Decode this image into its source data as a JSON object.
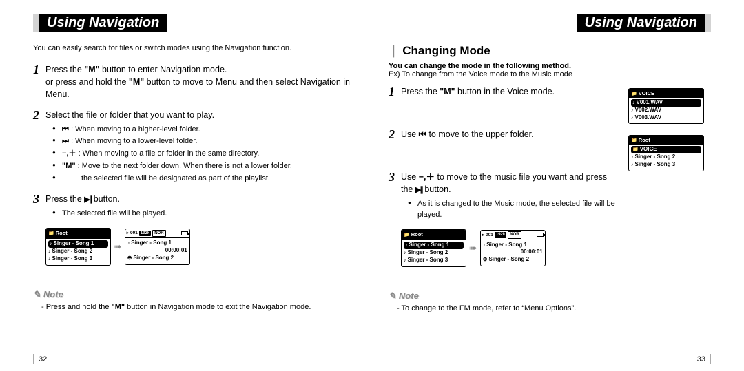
{
  "page_left": {
    "heading": "Using Navigation",
    "intro": "You can easily search for files or switch modes using the Navigation function.",
    "steps": [
      {
        "num": "1",
        "text_a": "Press the ",
        "bold_a": "\"M\"",
        "text_b": " button to enter Navigation mode.",
        "text_c": "or press and hold the ",
        "bold_b": "\"M\"",
        "text_d": " button to move to Menu and then select Navigation in Menu."
      },
      {
        "num": "2",
        "text_a": "Select the file or folder that you want to play.",
        "subitems": [
          {
            "glyph": "rew",
            "text": ": When moving to a higher-level folder."
          },
          {
            "glyph": "ffw",
            "text": ": When moving to a lower-level folder."
          },
          {
            "glyph": "pm",
            "text": ": When moving to a file or folder in the same directory."
          },
          {
            "glyph": "none",
            "bold": "\"M\"",
            "text": " : Move to the next folder down. When there is not a lower folder,"
          },
          {
            "glyph": "indent",
            "text": "the selected file will be designated as part of the playlist."
          }
        ]
      },
      {
        "num": "3",
        "text_a": "Press the ",
        "glyph": "playpause",
        "text_b": " button.",
        "subitems": [
          {
            "glyph": "none",
            "text": "The selected file will be played."
          }
        ]
      }
    ],
    "screen_a": {
      "header_icon": "folder",
      "header": "Root",
      "rows": [
        {
          "icon": "note",
          "text": "Singer - Song 1",
          "hl": true
        },
        {
          "icon": "note",
          "text": "Singer - Song 2"
        },
        {
          "icon": "note",
          "text": "Singer - Song 3"
        }
      ]
    },
    "screen_b": {
      "status": {
        "track": "001",
        "bitrate": "192k",
        "nor": "NOR"
      },
      "now_playing_icon": "note",
      "now_playing": "Singer - Song 1",
      "time": "00:00:01",
      "next_icon": "next",
      "next": "Singer - Song 2"
    },
    "note": {
      "label": "Note",
      "text_a": "- Press and hold the ",
      "bold": "\"M\"",
      "text_b": " button in Navigation mode to exit the Navigation mode."
    },
    "page_number": "32"
  },
  "page_right": {
    "heading": "Using Navigation",
    "section_title": "Changing Mode",
    "sub_intro": "You can change the mode in the following method.",
    "sub_example": "Ex) To change from the Voice mode to the Music mode",
    "steps": [
      {
        "num": "1",
        "text_a": "Press the ",
        "bold_a": "\"M\"",
        "text_b": " button in the Voice mode."
      },
      {
        "num": "2",
        "text_a": "Use ",
        "glyph": "rew",
        "text_b": " to move to the upper folder."
      },
      {
        "num": "3",
        "text_a": "Use ",
        "glyph": "pm",
        "text_b": " to move to the music file you want and press the ",
        "glyph2": "playpause",
        "text_c": " button.",
        "subitems": [
          {
            "glyph": "none",
            "text": "As it is changed to the Music mode, the selected file will be played."
          }
        ]
      }
    ],
    "screen_voice": {
      "header_icon": "folder",
      "header": "VOICE",
      "rows": [
        {
          "icon": "note",
          "text": "V001.WAV",
          "hl": true
        },
        {
          "icon": "note",
          "text": "V002.WAV"
        },
        {
          "icon": "note",
          "text": "V003.WAV"
        }
      ]
    },
    "screen_root": {
      "header_icon": "folder",
      "header": "Root",
      "rows": [
        {
          "icon": "folder",
          "text": "VOICE",
          "hl": true
        },
        {
          "icon": "note",
          "text": "Singer - Song 2"
        },
        {
          "icon": "note",
          "text": "Singer - Song 3"
        }
      ]
    },
    "screen_a": {
      "header_icon": "folder",
      "header": "Root",
      "rows": [
        {
          "icon": "note",
          "text": "Singer - Song 1",
          "hl": true
        },
        {
          "icon": "note",
          "text": "Singer - Song 2"
        },
        {
          "icon": "note",
          "text": "Singer - Song 3"
        }
      ]
    },
    "screen_b": {
      "status": {
        "track": "001",
        "bitrate": "192k",
        "nor": "NOR"
      },
      "now_playing_icon": "note",
      "now_playing": "Singer - Song 1",
      "time": "00:00:01",
      "next_icon": "next",
      "next": "Singer - Song 2"
    },
    "note": {
      "label": "Note",
      "text": "- To change to the FM mode, refer to “Menu Options”."
    },
    "page_number": "33"
  }
}
